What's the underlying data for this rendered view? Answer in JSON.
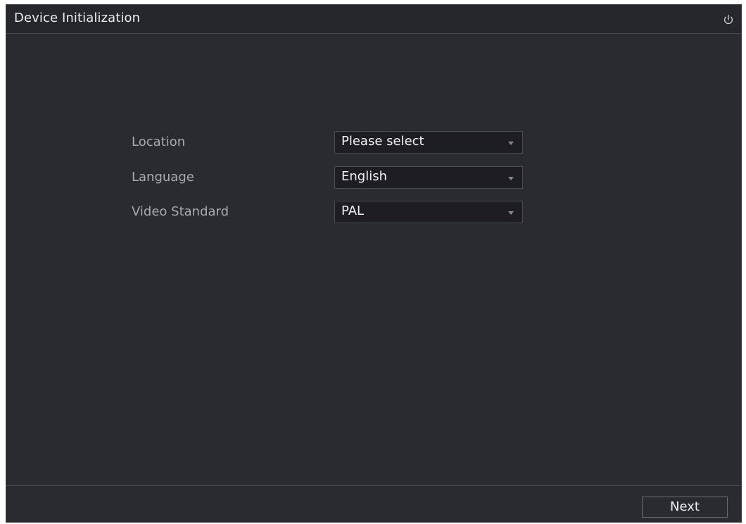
{
  "window": {
    "title": "Device Initialization"
  },
  "icons": {
    "power": "power-icon",
    "dropdown": "caret-down-icon"
  },
  "form": {
    "location": {
      "label": "Location",
      "value": "Please select"
    },
    "language": {
      "label": "Language",
      "value": "English"
    },
    "video_standard": {
      "label": "Video Standard",
      "value": "PAL"
    }
  },
  "footer": {
    "next_label": "Next"
  },
  "colors": {
    "background": "#2a2a31",
    "titlebar": "#26262d",
    "field_bg": "#1d1d23",
    "label_text": "#a9a9b0",
    "value_text": "#f2f2f2"
  }
}
